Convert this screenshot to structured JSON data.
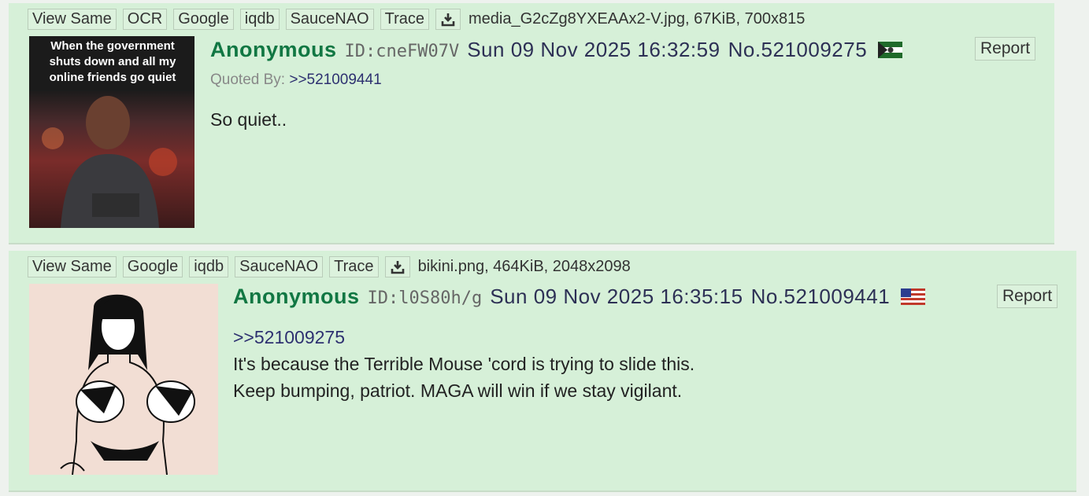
{
  "posts": [
    {
      "file_buttons": [
        "View Same",
        "OCR",
        "Google",
        "iqdb",
        "SauceNAO",
        "Trace"
      ],
      "file_info": "media_G2cZg8YXEAAx2-V.jpg, 67KiB, 700x815",
      "thumb_caption": "When the government shuts down and all my online friends go quiet",
      "name": "Anonymous",
      "id": "ID:cneFW07V",
      "datetime": "Sun 09 Nov 2025 16:32:59",
      "post_no": "No.521009275",
      "flag_icon": "flag-icon",
      "report": "Report",
      "quoted_by_label": "Quoted By:",
      "quoted_by_link": ">>521009441",
      "body_lines": [
        "So quiet.."
      ]
    },
    {
      "file_buttons": [
        "View Same",
        "Google",
        "iqdb",
        "SauceNAO",
        "Trace"
      ],
      "file_info": "bikini.png, 464KiB, 2048x2098",
      "name": "Anonymous",
      "id": "ID:l0S80h/g",
      "datetime": "Sun 09 Nov 2025 16:35:15",
      "post_no": "No.521009441",
      "flag_icon": "us-flag-icon",
      "report": "Report",
      "quote_link": ">>521009275",
      "body_lines": [
        "It's because the Terrible Mouse 'cord is trying to slide this.",
        "Keep bumping, patriot. MAGA will win if we stay vigilant."
      ]
    }
  ],
  "colors": {
    "post_bg": "#d6f0d8",
    "name": "#117743",
    "link": "#2d3070"
  }
}
